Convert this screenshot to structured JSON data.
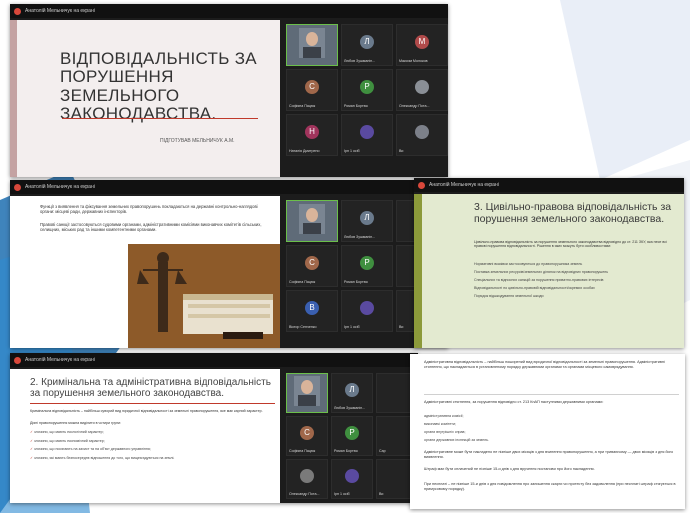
{
  "app": {
    "window_title": "Анатолій Мельничук на екрані"
  },
  "colors": {
    "background": "#ffffff",
    "zoom_bar": "#111111",
    "app_icon": "#d9483b",
    "tile_bg": "#232323",
    "active_speaker": "#6bbf4a",
    "slide_bg_pink": "#f3eeee",
    "slide_bg_green": "#e3ead0",
    "slide_accent_green": "#8c9a3a"
  },
  "shot1": {
    "slide_title": "ВІДПОВІДАЛЬНІСТЬ ЗА ПОРУШЕННЯ ЗЕМЕЛЬНОГО ЗАКОНОДАВСТВА.",
    "slide_subtitle": "ПІДГОТУВАВ МЕЛЬНИЧУК А.М.",
    "participants": [
      {
        "initial": "",
        "name": "",
        "video": true
      },
      {
        "initial": "Л",
        "name": "Любов Зушманін...",
        "color": "#6a7a8c"
      },
      {
        "initial": "М",
        "name": "Максим Молоков",
        "color": "#b04a4a"
      },
      {
        "initial": "С",
        "name": "Софіяна Пацюк",
        "color": "#a0674a"
      },
      {
        "initial": "Р",
        "name": "Роман Бортюк",
        "color": "#3f8f3f"
      },
      {
        "initial": "",
        "name": "Олександр Пота...",
        "video": false
      },
      {
        "initial": "Н",
        "name": "Наталія Дмитрено",
        "color": "#a0345c"
      },
      {
        "initial": "",
        "name": "Ірп 1 осіб",
        "video": false
      },
      {
        "initial": "",
        "name": "Ви",
        "video": false
      }
    ]
  },
  "shot2": {
    "para1": "Функції з виявлення та фіксування земельних правопорушень покладаються на державні контрольно-наглядові органи: місцеві ради, державних інспекторів.",
    "para2": "Правові санкції застосовуються судовими органами, адміністративними комісіями виконавчих комітетів сільських, селищних, міських рад та іншими компетентними органами.",
    "participants": [
      {
        "initial": "",
        "name": "",
        "video": true
      },
      {
        "initial": "Л",
        "name": "Любов Зушманін...",
        "color": "#6a7a8c"
      },
      {
        "initial": "",
        "name": "",
        "video": false
      },
      {
        "initial": "С",
        "name": "Софіяна Пацюк",
        "color": "#a0674a"
      },
      {
        "initial": "Р",
        "name": "Роман Бортюк",
        "color": "#3f8f3f"
      },
      {
        "initial": "",
        "name": "",
        "video": false
      },
      {
        "initial": "В",
        "name": "Віктор Сенченко",
        "color": "#3a5fb0"
      },
      {
        "initial": "",
        "name": "Ірп 1 осіб",
        "video": false
      },
      {
        "initial": "",
        "name": "Ви",
        "video": false
      }
    ]
  },
  "shot3": {
    "slide_title": "3. Цивільно-правова відповідальність за порушення земельного законодавства.",
    "intro": "Цивільно-правова відповідальність за порушення земельного законодавства відповідно до ст. 211 ЗКУ, яка несе всі правові порушення відповідальності. Рішення в яких можуть бути особливостями:",
    "items": [
      "Нормативні вказівки застосовуються до правопорушника земель",
      "Поставка земельних ресурсів/земельних ділянок на відповідних правопорушень",
      "Спеціальних та відносних санкцій за порушення приватно-правових інтересів",
      "Відповідальності по цивільно-правовій відповідальності/окремих особах",
      "Порядок відшкодування земельної шкоди"
    ]
  },
  "shot4": {
    "slide_title": "2. Кримінальна та адміністративна відповідальність за порушення земельного законодавства.",
    "intro": "Кримінальна відповідальність – найбільш суворий вид юридичної відповідальності за земельні правопорушення, яке має карний характер.",
    "lead": "Діяні правопорушення можна виділити в чотири групи:",
    "items": [
      "злочини, що мають екологічний характер;",
      "злочини, що мають економічний характер;",
      "злочини, що посягають на захист та на об'єкт державного управління;",
      "злочини, які мають безпосереднє відношення до того, що вищезгадуються на землі."
    ],
    "participants": [
      {
        "initial": "",
        "name": "",
        "video": true
      },
      {
        "initial": "Л",
        "name": "Любов Зушманін...",
        "color": "#6a7a8c"
      },
      {
        "initial": "",
        "name": "",
        "video": false
      },
      {
        "initial": "С",
        "name": "Софіяна Пацюк",
        "color": "#a0674a"
      },
      {
        "initial": "Р",
        "name": "Роман Бортюк",
        "color": "#3f8f3f"
      },
      {
        "initial": "",
        "name": "Сар",
        "video": false
      },
      {
        "initial": "",
        "name": "Олександр Пота...",
        "video": false
      },
      {
        "initial": "",
        "name": "Ірп 1 осіб",
        "video": false
      },
      {
        "initial": "",
        "name": "Ви",
        "video": false
      }
    ]
  },
  "shot5": {
    "para1": "Адміністративна відповідальність – найбільш поширений вид юридичної відповідальності за земельні правопорушення. Адміністративні стягнення, що накладаються в установленому порядку державними органами та органами місцевого самоврядування.",
    "para2": "Адміністративні стягнення, за порушення відповідно ст. 213 КпАП наступними державними органами:",
    "items": [
      "адміністративна комісії;",
      "виконавчі комітети;",
      "органи внутрішніх справ;",
      "органи державних інспекцій за земель."
    ],
    "para3": "Адміністративне може бути накладено не пізніше двох місяців з дня вчинення правопорушення, а при триваючому — двох місяців з дня його виявлення.",
    "para4": "Штраф має бути сплачений не пізніше 15-и днів з дня вручення постанови про його накладення.",
    "para5": "При несплаті – не пізніше 15-и днів з дня повідомлення про залишення скарги чи протесту без задоволення (при несплаті штраф стягується в примусовому порядку)."
  }
}
